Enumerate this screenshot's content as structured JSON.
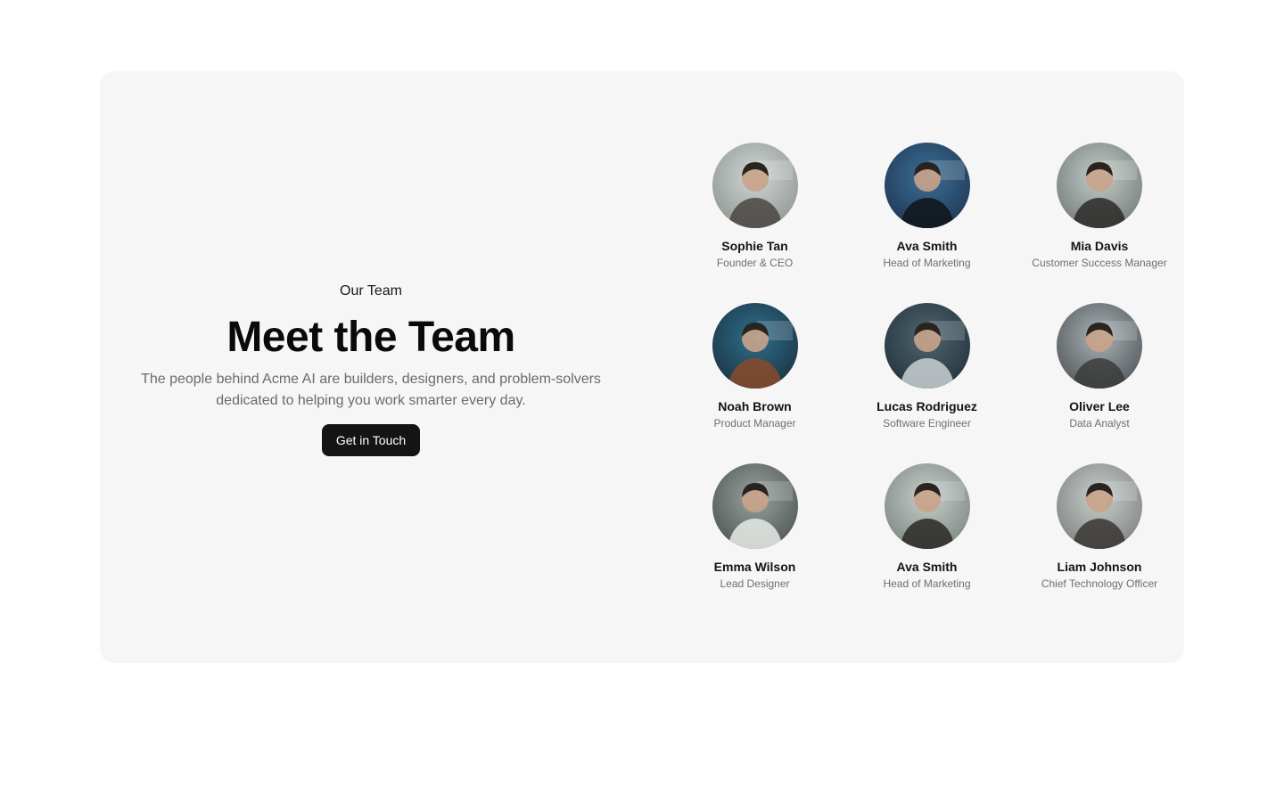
{
  "intro": {
    "eyebrow": "Our Team",
    "heading": "Meet the Team",
    "subtext": "The people behind Acme AI are builders, designers, and problem-solvers dedicated to helping you work smarter every day.",
    "cta_label": "Get in Touch"
  },
  "members": [
    {
      "name": "Sophie Tan",
      "role": "Founder & CEO",
      "bg": [
        "#cfd6d4",
        "#8d948f"
      ],
      "figure": "#4a4642"
    },
    {
      "name": "Ava Smith",
      "role": "Head of Marketing",
      "bg": [
        "#3c6f97",
        "#1d3550"
      ],
      "figure": "#101418"
    },
    {
      "name": "Mia Davis",
      "role": "Customer Success Manager",
      "bg": [
        "#c4cdc9",
        "#6f7874"
      ],
      "figure": "#2c2a28"
    },
    {
      "name": "Noah Brown",
      "role": "Product Manager",
      "bg": [
        "#2f6f8c",
        "#1a3040"
      ],
      "figure": "#8a4a2a"
    },
    {
      "name": "Lucas Rodriguez",
      "role": "Software Engineer",
      "bg": [
        "#4f6670",
        "#22303a"
      ],
      "figure": "#c9d0d2"
    },
    {
      "name": "Oliver Lee",
      "role": "Data Analyst",
      "bg": [
        "#aab3b6",
        "#4d5255"
      ],
      "figure": "#3b3b3b"
    },
    {
      "name": "Emma Wilson",
      "role": "Lead Designer",
      "bg": [
        "#9aa3a0",
        "#4a524f"
      ],
      "figure": "#e8ebe8"
    },
    {
      "name": "Ava Smith",
      "role": "Head of Marketing",
      "bg": [
        "#c6cfcb",
        "#7a847f"
      ],
      "figure": "#2a2826"
    },
    {
      "name": "Liam Johnson",
      "role": "Chief Technology Officer",
      "bg": [
        "#c8cfcc",
        "#7b7f7c"
      ],
      "figure": "#3a3634"
    }
  ]
}
